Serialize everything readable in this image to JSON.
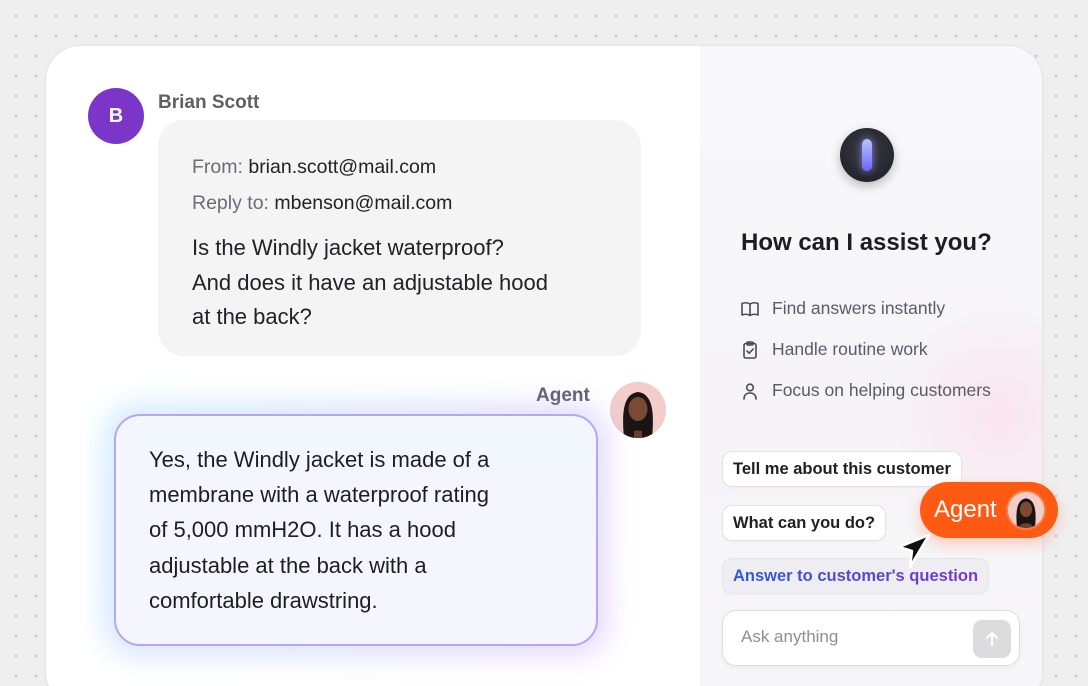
{
  "email": {
    "sender_name": "Brian Scott",
    "avatar_initial": "B",
    "from_label": "From:",
    "from_value": "brian.scott@mail.com",
    "reply_label": "Reply to:",
    "reply_value": "mbenson@mail.com",
    "body": [
      "Is the Windly jacket waterproof?",
      "And does it have an adjustable hood",
      "at the back?"
    ]
  },
  "reply": {
    "author": "Agent",
    "body": [
      "Yes, the Windly jacket is made of a",
      "membrane with a waterproof rating",
      "of 5,000 mmH2O. It has a hood",
      "adjustable at the back with a",
      "comfortable drawstring."
    ]
  },
  "assistant": {
    "title": "How can I assist you?",
    "features": [
      {
        "icon": "book-icon",
        "label": "Find answers instantly"
      },
      {
        "icon": "clipboard-check-icon",
        "label": "Handle routine work"
      },
      {
        "icon": "person-icon",
        "label": "Focus on helping customers"
      }
    ],
    "suggestions": [
      "Tell me about this customer",
      "What can you do?",
      "Answer to customer's question"
    ],
    "input_placeholder": "Ask anything"
  },
  "agent_tag": {
    "label": "Agent"
  },
  "colors": {
    "accent_orange": "#ff5a14",
    "avatar_purple": "#7b35c9",
    "gradient_blue": "#2c5bd8"
  }
}
